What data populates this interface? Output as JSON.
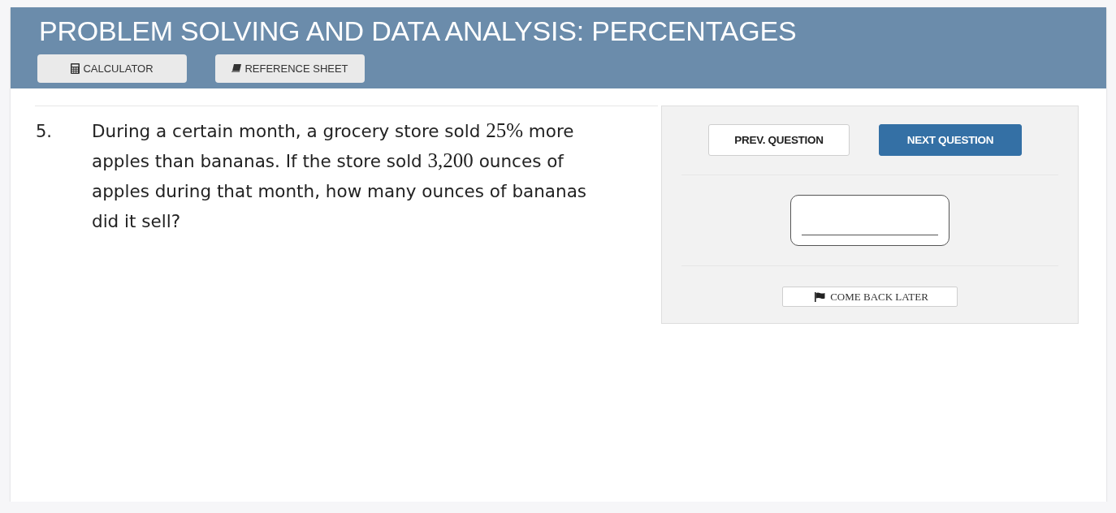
{
  "header": {
    "title": "PROBLEM SOLVING AND DATA ANALYSIS: PERCENTAGES",
    "tools": [
      {
        "kind": "calculator",
        "label": "CALCULATOR"
      },
      {
        "kind": "reference",
        "label": "REFERENCE SHEET"
      }
    ]
  },
  "question": {
    "number": "5.",
    "segments": [
      {
        "kind": "text",
        "text": "During a certain month, a grocery store sold "
      },
      {
        "kind": "math",
        "text": "25%"
      },
      {
        "kind": "text",
        "text": " more apples than bananas. If the store sold "
      },
      {
        "kind": "math",
        "text": "3,200"
      },
      {
        "kind": "text",
        "text": " ounces of apples during that month, how many ounces of bananas did it sell?"
      }
    ]
  },
  "navigation": {
    "buttons": [
      {
        "kind": "secondary",
        "label": "PREV. QUESTION"
      },
      {
        "kind": "primary",
        "label": "NEXT QUESTION"
      }
    ]
  },
  "flag": {
    "label": "COME BACK LATER"
  }
}
